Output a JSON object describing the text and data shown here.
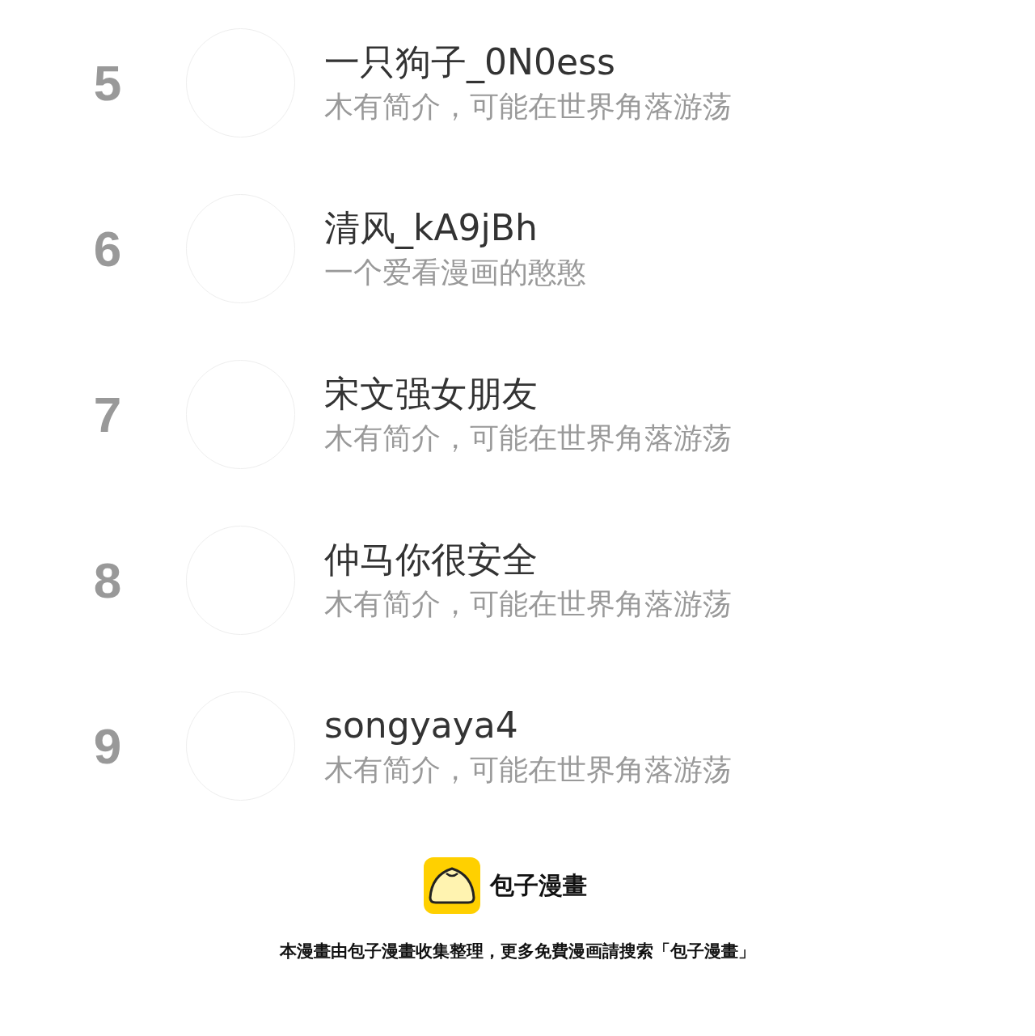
{
  "ranking": [
    {
      "rank": "5",
      "name": "一只狗子_0N0ess",
      "bio": "木有简介，可能在世界角落游荡"
    },
    {
      "rank": "6",
      "name": "清风_kA9jBh",
      "bio": "一个爱看漫画的憨憨"
    },
    {
      "rank": "7",
      "name": "宋文强女朋友",
      "bio": "木有简介，可能在世界角落游荡"
    },
    {
      "rank": "8",
      "name": "仲马你很安全",
      "bio": "木有简介，可能在世界角落游荡"
    },
    {
      "rank": "9",
      "name": "songyaya4",
      "bio": "木有简介，可能在世界角落游荡"
    }
  ],
  "footer": {
    "brand": "包子漫畫",
    "notice": "本漫畫由包子漫畫收集整理，更多免費漫画請搜索「包子漫畫」"
  }
}
